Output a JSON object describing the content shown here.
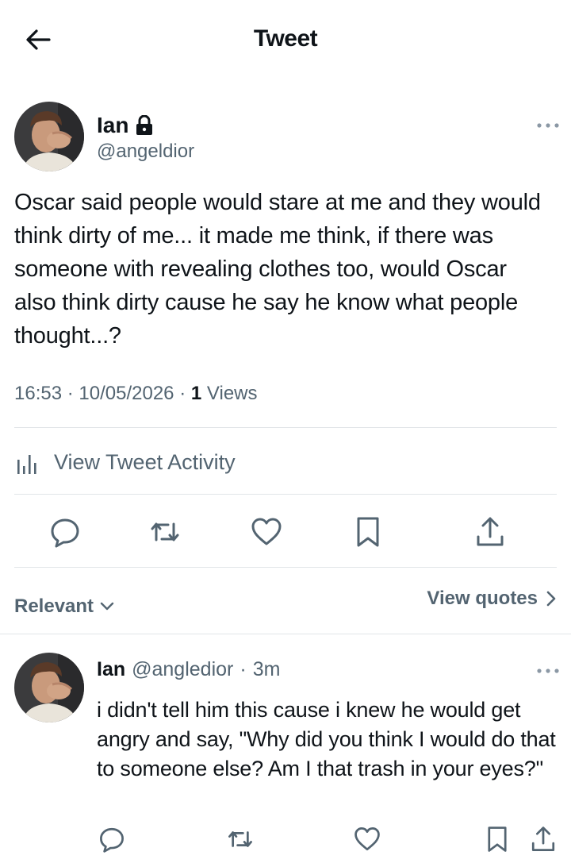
{
  "header": {
    "title": "Tweet",
    "back_icon": "arrow-left-icon"
  },
  "tweet": {
    "author_name": "Ian",
    "author_handle": "@angeldior",
    "protected_icon": "lock-icon",
    "text": "Oscar said people would stare at me and they would think dirty of me... it made me think, if there was someone with revealing clothes too, would Oscar also think dirty cause he say he know what people thought...?",
    "time": "16:53",
    "date": "10/05/2026",
    "separator": "·",
    "views_count": "1",
    "views_label": "Views",
    "activity_label": "View Tweet Activity"
  },
  "actions": {
    "icons": [
      "reply-icon",
      "retweet-icon",
      "like-icon",
      "bookmark-icon",
      "share-icon"
    ]
  },
  "filters": {
    "sort_label": "Relevant",
    "quotes_label": "View quotes"
  },
  "reply": {
    "author_name": "Ian",
    "author_handle": "@angledior",
    "separator": "·",
    "time": "3m",
    "text": "i didn't tell him this cause i knew he would get angry and say, \"Why did you think I would do that to someone else? Am I that trash in your eyes?\""
  },
  "colors": {
    "text_primary": "#0f1419",
    "text_secondary": "#536471",
    "divider": "#e1e5e8",
    "background": "#ffffff"
  }
}
